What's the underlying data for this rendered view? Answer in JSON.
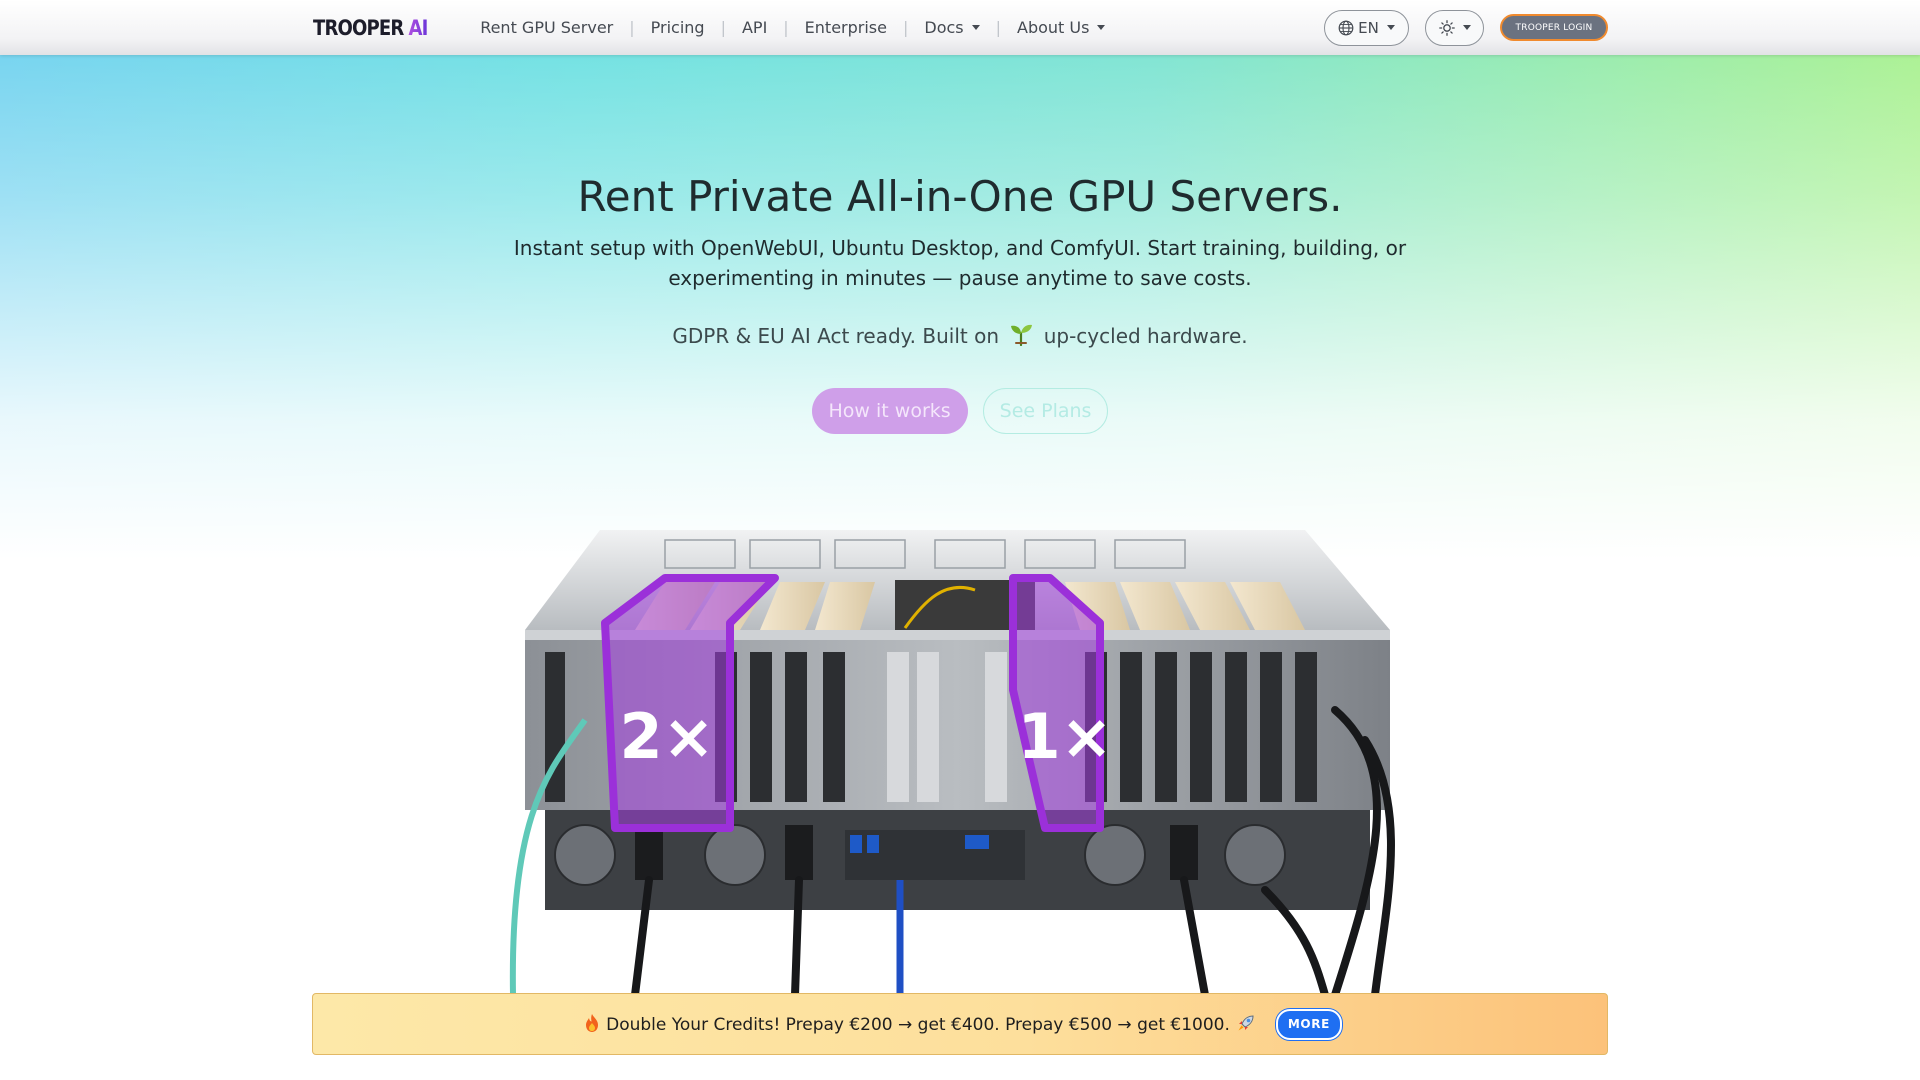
{
  "nav": {
    "brand": "TROOPER",
    "brand_ai": "AI",
    "links": [
      {
        "label": "Rent GPU Server",
        "dropdown": false
      },
      {
        "label": "Pricing",
        "dropdown": false
      },
      {
        "label": "API",
        "dropdown": false
      },
      {
        "label": "Enterprise",
        "dropdown": false
      },
      {
        "label": "Docs",
        "dropdown": true
      },
      {
        "label": "About Us",
        "dropdown": true
      }
    ],
    "language": "EN",
    "theme_icon": "sun-icon",
    "login_label": "TROOPER LOGIN"
  },
  "hero": {
    "title": "Rent Private All-in-One GPU Servers.",
    "subtitle": "Instant setup with OpenWebUI, Ubuntu Desktop, and ComfyUI. Start training, building, or experimenting in minutes — pause anytime to save costs.",
    "note_before": "GDPR & EU AI Act ready. Built on",
    "note_icon": "sprout-icon",
    "note_after": "up-cycled hardware.",
    "cta_primary": "How it works",
    "cta_secondary": "See Plans"
  },
  "server_image": {
    "label_left": "2×",
    "label_right": "1×",
    "accent_color": "#9b30d9"
  },
  "promo": {
    "icon_left": "fire-icon",
    "text": "Double Your Credits! Prepay €200 → get €400. Prepay €500 → get €1000.",
    "icon_right": "rocket-icon",
    "more_label": "MORE"
  },
  "colors": {
    "gradient_left": "#6ad0ee",
    "gradient_right": "#a4f08a",
    "cta_primary": "#cf9fe9",
    "more_button": "#1f6ff2",
    "login_border": "#f08a2e"
  }
}
